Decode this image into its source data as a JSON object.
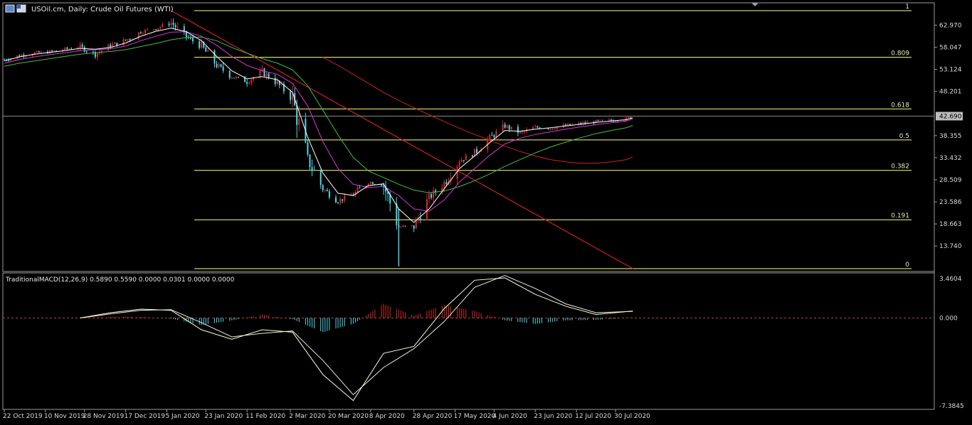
{
  "header": {
    "symbol_text": "USOil.cm, Daily:  Crude Oil Futures (WTI)"
  },
  "macd": {
    "label": "TraditionalMACD(12,26,9) 0.5890 0.5590 0.0000 0.0301 0.0000 0.0000",
    "y_ticks": [
      "3.4604",
      "0.000",
      "-7.3845"
    ]
  },
  "price_axis": {
    "ticks": [
      "62.970",
      "58.047",
      "53.124",
      "48.201",
      "38.355",
      "33.432",
      "28.509",
      "23.586",
      "18.663",
      "13.740"
    ],
    "current_price": "42.690"
  },
  "fibo_levels": [
    {
      "label": "1",
      "price": 66.2
    },
    {
      "label": "0.809",
      "price": 55.8
    },
    {
      "label": "0.618",
      "price": 44.3
    },
    {
      "label": "0.5",
      "price": 37.4
    },
    {
      "label": "0.382",
      "price": 30.6
    },
    {
      "label": "0.191",
      "price": 19.6
    },
    {
      "label": "0",
      "price": 8.7
    }
  ],
  "date_axis": {
    "labels": [
      "22 Oct 2019",
      "10 Nov 2019",
      "28 Nov 2019",
      "17 Dec 2019",
      "5 Jan 2020",
      "23 Jan 2020",
      "11 Feb 2020",
      "2 Mar 2020",
      "20 Mar 2020",
      "8 Apr 2020",
      "28 Apr 2020",
      "17 May 2020",
      "4 Jun 2020",
      "23 Jun 2020",
      "12 Jul 2020",
      "30 Jul 2020"
    ]
  },
  "colors": {
    "bull": "#d22b2b",
    "bear": "#4fd6e6",
    "fibo": "#ffff80",
    "trend": "#cc2222",
    "ma_fast": "#ffffff",
    "ma_mid": "#d23ad2",
    "ma_slow": "#40c040",
    "ma_long": "#cc2222",
    "macd_line": "#ffffcc",
    "signal_line": "#e8e8e8"
  },
  "chart_data": [
    {
      "type": "candlestick",
      "title": "USOil.cm, Daily:  Crude Oil Futures (WTI)",
      "x": [
        "2019-10-22",
        "2019-10-29",
        "2019-11-05",
        "2019-11-12",
        "2019-11-19",
        "2019-11-26",
        "2019-12-03",
        "2019-12-10",
        "2019-12-17",
        "2019-12-24",
        "2019-12-31",
        "2020-01-07",
        "2020-01-14",
        "2020-01-21",
        "2020-01-28",
        "2020-02-04",
        "2020-02-11",
        "2020-02-18",
        "2020-02-25",
        "2020-03-03",
        "2020-03-10",
        "2020-03-17",
        "2020-03-24",
        "2020-03-31",
        "2020-04-07",
        "2020-04-14",
        "2020-04-21",
        "2020-04-28",
        "2020-05-05",
        "2020-05-12",
        "2020-05-19",
        "2020-05-26",
        "2020-06-02",
        "2020-06-09",
        "2020-06-16",
        "2020-06-23",
        "2020-06-30",
        "2020-07-07",
        "2020-07-14",
        "2020-07-21",
        "2020-07-28",
        "2020-08-04",
        "2020-08-07"
      ],
      "close": [
        55.3,
        56.2,
        56.8,
        57.0,
        57.6,
        58.1,
        56.5,
        58.4,
        59.6,
        61.5,
        62.3,
        63.5,
        60.4,
        58.2,
        54.0,
        51.5,
        50.4,
        52.6,
        50.0,
        46.5,
        33.0,
        26.5,
        23.8,
        25.2,
        28.0,
        27.4,
        18.0,
        18.2,
        24.5,
        27.8,
        32.8,
        34.5,
        37.8,
        40.5,
        38.9,
        40.2,
        40.0,
        40.6,
        41.0,
        41.5,
        41.7,
        42.0,
        42.69
      ],
      "ma_fast": [
        55.0,
        55.9,
        56.5,
        56.9,
        57.3,
        57.8,
        57.6,
        58.0,
        59.0,
        60.5,
        61.6,
        62.3,
        61.5,
        59.5,
        56.0,
        52.8,
        51.0,
        51.5,
        50.8,
        48.0,
        38.0,
        30.0,
        25.5,
        25.0,
        27.2,
        27.6,
        22.0,
        19.0,
        22.0,
        26.5,
        31.0,
        33.8,
        36.8,
        39.5,
        39.3,
        39.8,
        40.1,
        40.5,
        40.9,
        41.3,
        41.6,
        41.9,
        42.3
      ],
      "ma_mid": [
        54.5,
        55.3,
        55.9,
        56.4,
        56.8,
        57.3,
        57.5,
        57.7,
        58.3,
        59.5,
        60.5,
        61.4,
        61.5,
        60.5,
        58.5,
        56.0,
        54.0,
        52.8,
        52.0,
        50.0,
        45.0,
        37.0,
        31.0,
        27.5,
        26.8,
        27.0,
        25.0,
        22.0,
        21.5,
        24.0,
        28.0,
        31.0,
        34.0,
        36.5,
        37.8,
        38.6,
        39.2,
        39.8,
        40.3,
        40.8,
        41.2,
        41.6,
        42.0
      ],
      "ma_slow": [
        53.8,
        54.5,
        55.0,
        55.5,
        56.0,
        56.5,
        56.8,
        57.1,
        57.5,
        58.2,
        58.9,
        59.7,
        60.2,
        60.3,
        59.5,
        58.0,
        56.7,
        55.5,
        54.5,
        53.0,
        49.5,
        44.0,
        38.5,
        33.5,
        30.5,
        29.0,
        27.5,
        26.2,
        25.6,
        26.0,
        27.0,
        28.3,
        29.8,
        31.5,
        33.0,
        34.5,
        35.8,
        36.9,
        37.9,
        38.8,
        39.5,
        40.1,
        40.6
      ],
      "ma_long": [
        null,
        null,
        null,
        null,
        null,
        null,
        null,
        null,
        null,
        null,
        null,
        null,
        null,
        null,
        null,
        null,
        null,
        null,
        null,
        null,
        null,
        55.8,
        54.0,
        52.0,
        50.0,
        48.0,
        46.2,
        44.6,
        43.0,
        41.5,
        40.0,
        38.6,
        37.3,
        36.0,
        34.8,
        33.8,
        33.0,
        32.5,
        32.2,
        32.2,
        32.5,
        33.0,
        33.6
      ],
      "trendline": [
        {
          "x": "2020-01-07",
          "y": 66.2
        },
        {
          "x": "2020-08-07",
          "y": 8.7
        }
      ],
      "fib_levels": [
        1,
        0.809,
        0.618,
        0.5,
        0.382,
        0.191,
        0
      ],
      "fib_prices": [
        66.2,
        55.8,
        44.3,
        37.4,
        30.6,
        19.6,
        8.7
      ],
      "ylim": [
        8.7,
        66.2
      ],
      "current_price": 42.69
    },
    {
      "type": "macd",
      "title": "TraditionalMACD(12,26,9) 0.5890 0.5590 0.0000 0.0301 0.0000 0.0000",
      "x": [
        "2019-11-26",
        "2019-12-10",
        "2019-12-24",
        "2020-01-07",
        "2020-01-21",
        "2020-02-04",
        "2020-02-18",
        "2020-03-03",
        "2020-03-17",
        "2020-03-31",
        "2020-04-14",
        "2020-04-28",
        "2020-05-12",
        "2020-05-26",
        "2020-06-09",
        "2020-06-23",
        "2020-07-07",
        "2020-07-21",
        "2020-08-07"
      ],
      "macd": [
        0.0,
        0.45,
        0.75,
        0.65,
        -1.0,
        -1.8,
        -1.0,
        -1.2,
        -4.8,
        -7.0,
        -3.0,
        -2.4,
        0.8,
        3.2,
        3.4,
        2.0,
        1.0,
        0.3,
        0.59
      ],
      "signal": [
        0.0,
        0.35,
        0.65,
        0.7,
        -0.4,
        -1.6,
        -1.3,
        -1.1,
        -3.6,
        -6.5,
        -4.2,
        -2.6,
        -0.3,
        2.6,
        3.6,
        2.5,
        1.2,
        0.45,
        0.56
      ],
      "histogram": [
        0.0,
        0.1,
        0.1,
        -0.05,
        -0.6,
        -0.2,
        0.3,
        -0.1,
        -1.2,
        -0.5,
        1.2,
        0.2,
        1.1,
        0.6,
        -0.2,
        -0.5,
        -0.2,
        -0.15,
        0.03
      ],
      "ylim": [
        -7.3845,
        3.4604
      ]
    }
  ]
}
